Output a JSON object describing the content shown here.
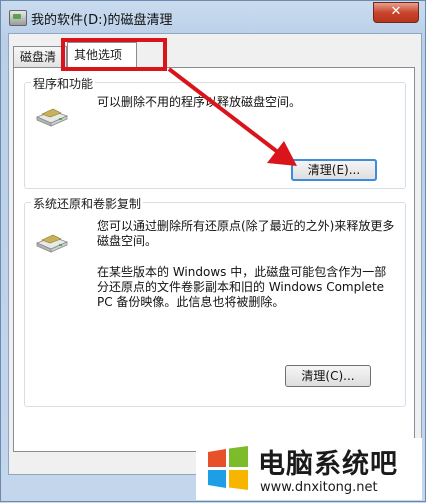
{
  "window": {
    "title": "我的软件(D:)的磁盘清理",
    "close_label": "✕"
  },
  "tabs": [
    {
      "label": "磁盘清理"
    },
    {
      "label": "其他选项"
    }
  ],
  "programs_group": {
    "title": "程序和功能",
    "description": "可以删除不用的程序以释放磁盘空间。",
    "button_label": "清理(E)..."
  },
  "restore_group": {
    "title": "系统还原和卷影复制",
    "description_1": "您可以通过删除所有还原点(除了最近的之外)来释放更多磁盘空间。",
    "description_2": "在某些版本的 Windows 中，此磁盘可能包含作为一部分还原点的文件卷影副本和旧的 Windows Complete PC 备份映像。此信息也将被删除。",
    "button_label": "清理(C)..."
  },
  "watermark": {
    "brand": "电脑系统吧",
    "url": "www.dnxitong.net"
  },
  "colors": {
    "annotation_red": "#d9141b",
    "title_bar": "#c9dbef"
  }
}
